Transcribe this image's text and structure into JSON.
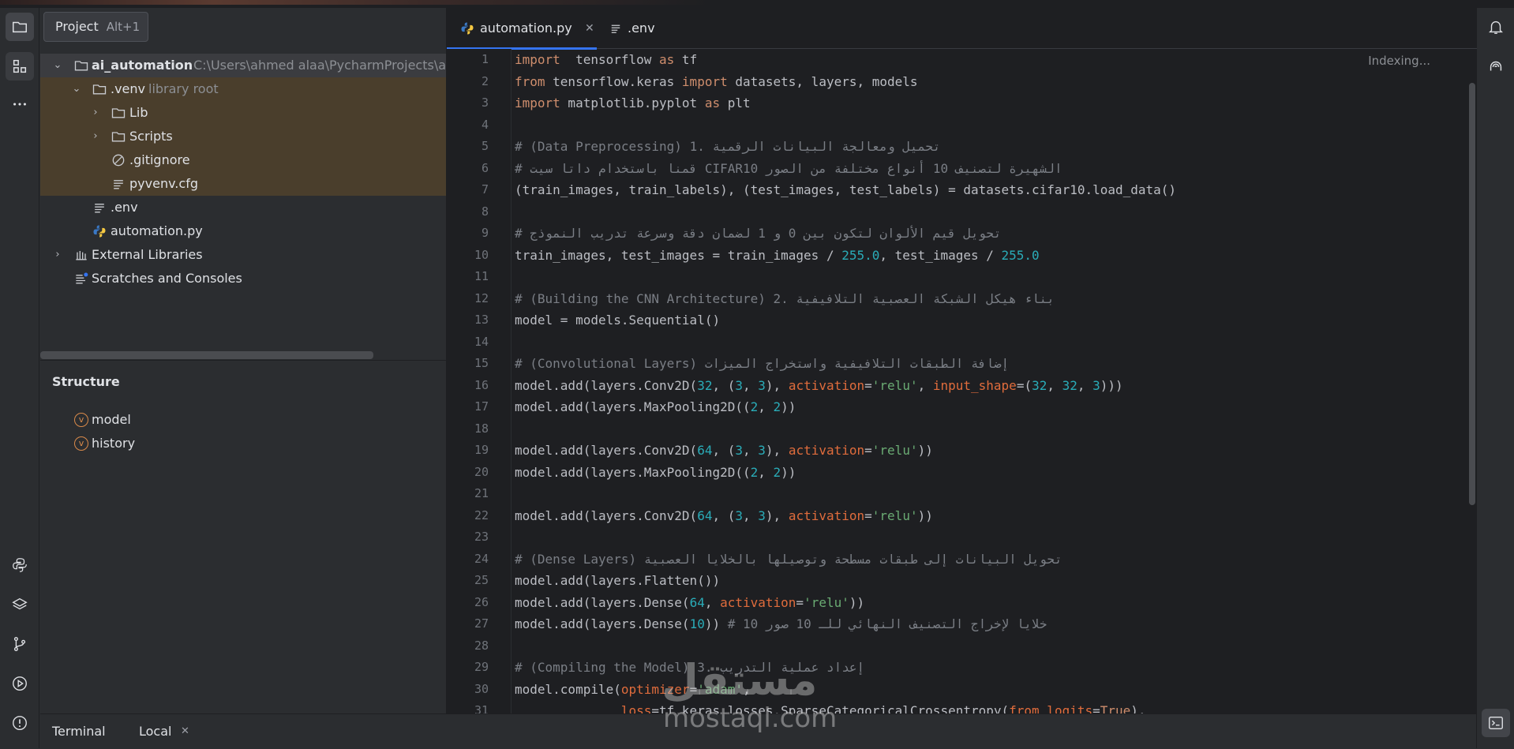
{
  "tooltip": {
    "label": "Project",
    "shortcut": "Alt+1"
  },
  "project_tree": {
    "root_name": "ai_automation",
    "root_path": "C:\\Users\\ahmed alaa\\PycharmProjects\\ai_",
    "venv_name": ".venv",
    "venv_hint": "library root",
    "lib": "Lib",
    "scripts": "Scripts",
    "gitignore": ".gitignore",
    "pyvenv": "pyvenv.cfg",
    "env": ".env",
    "automation": "automation.py",
    "external": "External Libraries",
    "scratches": "Scratches and Consoles"
  },
  "structure": {
    "title": "Structure",
    "items": [
      "model",
      "history"
    ],
    "badge": "v"
  },
  "editor": {
    "tabs": [
      {
        "label": "automation.py"
      },
      {
        "label": ".env"
      }
    ],
    "close_glyph": "✕",
    "indexing": "Indexing...",
    "line_numbers": [
      "1",
      "2",
      "3",
      "4",
      "5",
      "6",
      "7",
      "8",
      "9",
      "10",
      "11",
      "12",
      "13",
      "14",
      "15",
      "16",
      "17",
      "18",
      "19",
      "20",
      "21",
      "22",
      "23",
      "24",
      "25",
      "26",
      "27",
      "28",
      "29",
      "30",
      "31"
    ],
    "lines": [
      [
        [
          "kw",
          "import"
        ],
        [
          "",
          "  tensorflow "
        ],
        [
          "kw",
          "as"
        ],
        [
          "",
          " tf"
        ]
      ],
      [
        [
          "kw",
          "from"
        ],
        [
          "",
          " tensorflow.keras "
        ],
        [
          "kw",
          "import"
        ],
        [
          "",
          " datasets, layers, models"
        ]
      ],
      [
        [
          "kw",
          "import"
        ],
        [
          "",
          " matplotlib.pyplot "
        ],
        [
          "kw",
          "as"
        ],
        [
          "",
          " plt"
        ]
      ],
      [],
      [
        [
          "cm",
          "# (Data Preprocessing) تحميل ومعالجة البيانات الرقمية .1"
        ]
      ],
      [
        [
          "cm",
          "# قمنا باستخدام داتا سيت CIFAR10 الشهيرة لتصنيف 10 أنواع مختلفة من الصور"
        ]
      ],
      [
        [
          "",
          "(train_images, train_labels), (test_images, test_labels) = datasets.cifar10.load_data()"
        ]
      ],
      [],
      [
        [
          "cm",
          "# تحويل قيم الألوان لتكون بين 0 و 1 لضمان دقة وسرعة تدريب النموذج"
        ]
      ],
      [
        [
          "",
          "train_images, test_images = train_images / "
        ],
        [
          "num",
          "255.0"
        ],
        [
          "",
          ", test_images / "
        ],
        [
          "num",
          "255.0"
        ]
      ],
      [],
      [
        [
          "cm",
          "# (Building the CNN Architecture) بناء هيكل الشبكة العصبية التلافيفية .2"
        ]
      ],
      [
        [
          "",
          "model = models.Sequential()"
        ]
      ],
      [],
      [
        [
          "cm",
          "# (Convolutional Layers) إضافة الطبقات التلافيفية واستخراج الميزات"
        ]
      ],
      [
        [
          "",
          "model.add(layers.Conv2D("
        ],
        [
          "num",
          "32"
        ],
        [
          "",
          ", ("
        ],
        [
          "num",
          "3"
        ],
        [
          "",
          ", "
        ],
        [
          "num",
          "3"
        ],
        [
          "",
          "), "
        ],
        [
          "prm",
          "activation"
        ],
        [
          "",
          "="
        ],
        [
          "str",
          "'relu'"
        ],
        [
          "",
          ", "
        ],
        [
          "prm",
          "input_shape"
        ],
        [
          "",
          "=("
        ],
        [
          "num",
          "32"
        ],
        [
          "",
          ", "
        ],
        [
          "num",
          "32"
        ],
        [
          "",
          ", "
        ],
        [
          "num",
          "3"
        ],
        [
          "",
          ")))"
        ]
      ],
      [
        [
          "",
          "model.add(layers.MaxPooling2D(("
        ],
        [
          "num",
          "2"
        ],
        [
          "",
          ", "
        ],
        [
          "num",
          "2"
        ],
        [
          "",
          "))"
        ]
      ],
      [],
      [
        [
          "",
          "model.add(layers.Conv2D("
        ],
        [
          "num",
          "64"
        ],
        [
          "",
          ", ("
        ],
        [
          "num",
          "3"
        ],
        [
          "",
          ", "
        ],
        [
          "num",
          "3"
        ],
        [
          "",
          "), "
        ],
        [
          "prm",
          "activation"
        ],
        [
          "",
          "="
        ],
        [
          "str",
          "'relu'"
        ],
        [
          "",
          "))"
        ]
      ],
      [
        [
          "",
          "model.add(layers.MaxPooling2D(("
        ],
        [
          "num",
          "2"
        ],
        [
          "",
          ", "
        ],
        [
          "num",
          "2"
        ],
        [
          "",
          "))"
        ]
      ],
      [],
      [
        [
          "",
          "model.add(layers.Conv2D("
        ],
        [
          "num",
          "64"
        ],
        [
          "",
          ", ("
        ],
        [
          "num",
          "3"
        ],
        [
          "",
          ", "
        ],
        [
          "num",
          "3"
        ],
        [
          "",
          "), "
        ],
        [
          "prm",
          "activation"
        ],
        [
          "",
          "="
        ],
        [
          "str",
          "'relu'"
        ],
        [
          "",
          "))"
        ]
      ],
      [],
      [
        [
          "cm",
          "# (Dense Layers) تحويل البيانات إلى طبقات مسطحة وتوصيلها بالخلايا العصبية"
        ]
      ],
      [
        [
          "",
          "model.add(layers.Flatten())"
        ]
      ],
      [
        [
          "",
          "model.add(layers.Dense("
        ],
        [
          "num",
          "64"
        ],
        [
          "",
          ", "
        ],
        [
          "prm",
          "activation"
        ],
        [
          "",
          "="
        ],
        [
          "str",
          "'relu'"
        ],
        [
          "",
          "))"
        ]
      ],
      [
        [
          "",
          "model.add(layers.Dense("
        ],
        [
          "num",
          "10"
        ],
        [
          "",
          ")) "
        ],
        [
          "cm",
          "# 10 خلايا لإخراج التصنيف النهائي للـ 10 صور"
        ]
      ],
      [],
      [
        [
          "cm",
          "# (Compiling the Model) إعداد عملية التدريب .3"
        ]
      ],
      [
        [
          "",
          "model.compile("
        ],
        [
          "prm",
          "optimizer"
        ],
        [
          "",
          "="
        ],
        [
          "str",
          "'adam'"
        ],
        [
          "",
          ","
        ]
      ],
      [
        [
          "",
          "              "
        ],
        [
          "prm",
          "loss"
        ],
        [
          "",
          "=tf.keras.losses.SparseCategoricalCrossentropy("
        ],
        [
          "prm",
          "from_logits"
        ],
        [
          "",
          "="
        ],
        [
          "kw",
          "True"
        ],
        [
          "",
          "),"
        ]
      ]
    ]
  },
  "bottom": {
    "terminal": "Terminal",
    "local": "Local",
    "close": "✕"
  },
  "watermark": {
    "ar": "مستقل",
    "en": "mostaql.com"
  }
}
